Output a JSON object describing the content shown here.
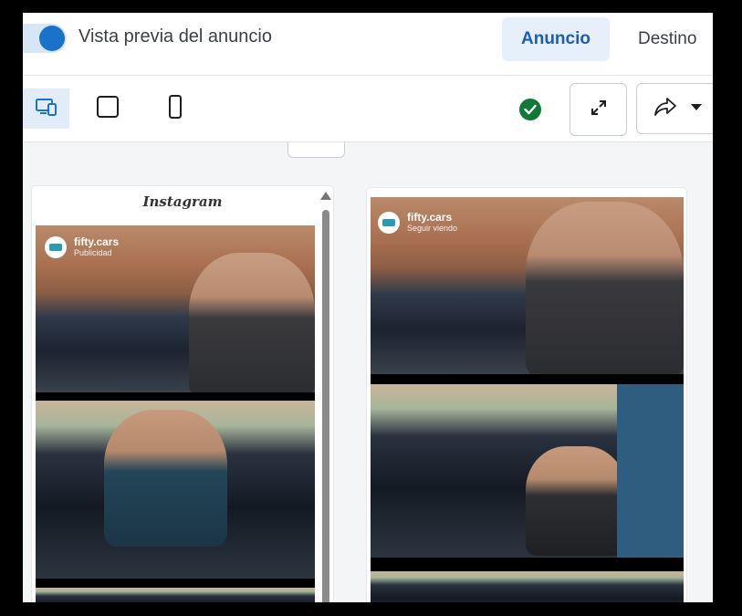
{
  "header": {
    "toggle_label": "Vista previa del anuncio",
    "toggle_on": true,
    "tabs": [
      {
        "label": "Anuncio",
        "active": true
      },
      {
        "label": "Destino",
        "active": false
      }
    ]
  },
  "toolbar": {
    "devices": [
      {
        "icon": "desktop-mobile-icon",
        "active": true
      },
      {
        "icon": "square-icon",
        "active": false
      },
      {
        "icon": "mobile-phone-icon",
        "active": false
      }
    ],
    "status_icon": "checkmark-circle-icon",
    "expand_icon": "expand-icon",
    "share_icon": "share-icon",
    "dropdown_icon": "caret-down-icon"
  },
  "previews": [
    {
      "platform_title": "Instagram",
      "account_name": "fifty.cars",
      "account_subtitle": "Publicidad"
    },
    {
      "platform_title": "",
      "account_name": "fifty.cars",
      "account_subtitle": "Seguir viendo"
    }
  ],
  "colors": {
    "accent": "#1a73c9",
    "active_tab_bg": "#e7f0fa",
    "status_green": "#0f7a35"
  }
}
